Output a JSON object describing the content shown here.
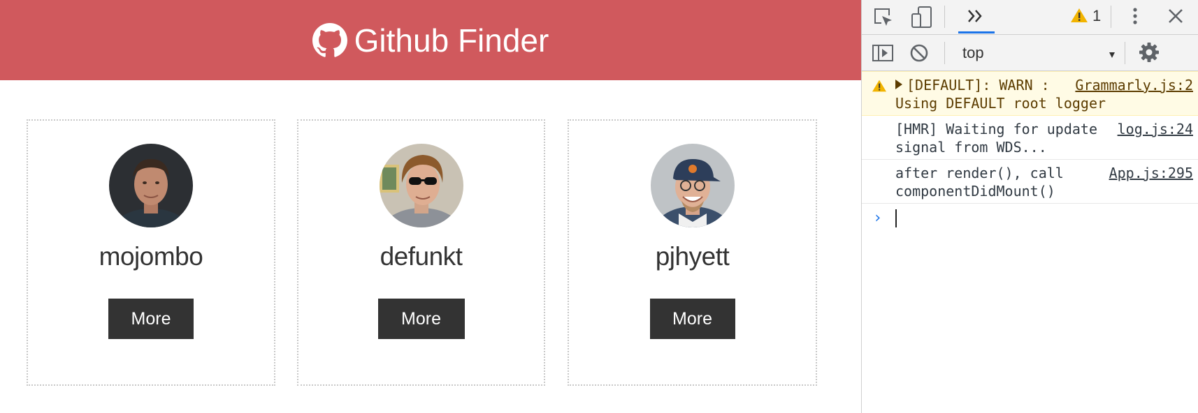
{
  "app": {
    "title": "Github Finder",
    "icon": "github-icon",
    "users": [
      {
        "login": "mojombo",
        "button_label": "More"
      },
      {
        "login": "defunkt",
        "button_label": "More"
      },
      {
        "login": "pjhyett",
        "button_label": "More"
      }
    ]
  },
  "devtools": {
    "tabs": {
      "inspect_icon": "inspect-element-icon",
      "device_icon": "device-toolbar-icon",
      "more_tabs_icon": "double-chevron-icon",
      "warning_count": "1",
      "menu_icon": "kebab-menu-icon",
      "close_icon": "close-icon"
    },
    "toolbar": {
      "context": "top",
      "sidebar_icon": "show-sidebar-icon",
      "clear_icon": "clear-console-icon",
      "settings_icon": "gear-icon"
    },
    "messages": [
      {
        "level": "warning",
        "text": "[DEFAULT]: WARN : Using DEFAULT root logger",
        "source": "Grammarly.js:2"
      },
      {
        "level": "info",
        "text": "[HMR] Waiting for update signal from WDS...",
        "source": "log.js:24"
      },
      {
        "level": "info",
        "text": "after render(), call componentDidMount()",
        "source": "App.js:295"
      }
    ],
    "prompt_symbol": "›"
  },
  "colors": {
    "navbar": "#d0595d",
    "button": "#333333",
    "accent": "#1a73e8",
    "warning_bg": "#fffbe5"
  }
}
